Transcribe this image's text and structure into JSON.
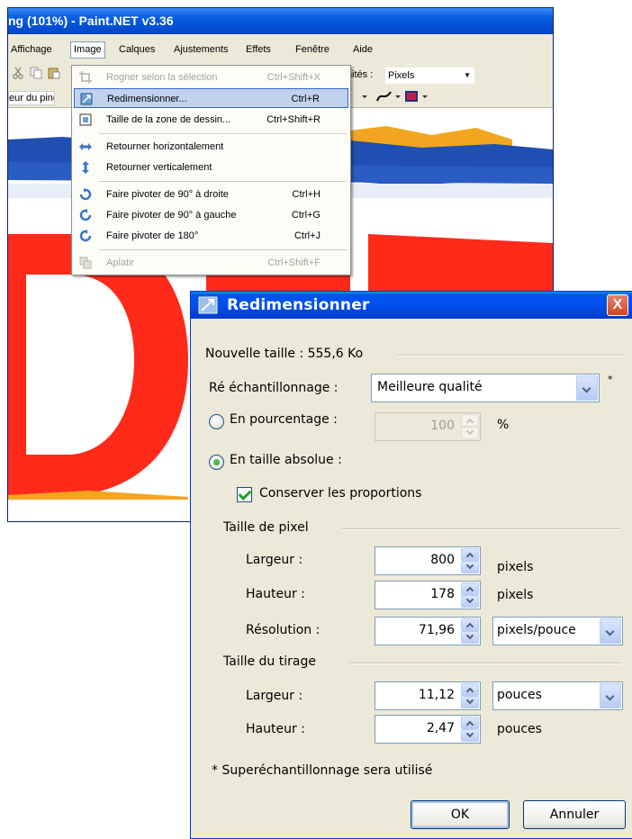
{
  "main_window": {
    "title": "ng (101%) - Paint.NET v3.36",
    "menu": [
      "Affichage",
      "Image",
      "Calques",
      "Ajustements",
      "Effets",
      "Fenêtre",
      "Aide"
    ],
    "units_label": "Unités :",
    "units_value": "Pixels",
    "brush_label": "eur du pince"
  },
  "image_menu": [
    {
      "label": "Rogner selon la sélection",
      "shortcut": "Ctrl+Shift+X",
      "disabled": true
    },
    {
      "label": "Redimensionner...",
      "shortcut": "Ctrl+R"
    },
    {
      "label": "Taille de la zone de dessin...",
      "shortcut": "Ctrl+Shift+R"
    },
    {
      "label": "Retourner horizontalement",
      "shortcut": ""
    },
    {
      "label": "Retourner verticalement",
      "shortcut": ""
    },
    {
      "label": "Faire pivoter de 90° à droite",
      "shortcut": "Ctrl+H"
    },
    {
      "label": "Faire pivoter de 90° à gauche",
      "shortcut": "Ctrl+G"
    },
    {
      "label": "Faire pivoter de 180°",
      "shortcut": "Ctrl+J"
    },
    {
      "label": "Aplatir",
      "shortcut": "Ctrl+Shift+F",
      "disabled": true
    }
  ],
  "dialog": {
    "title": "Redimensionner",
    "close": "X",
    "new_size": "Nouvelle taille : 555,6 Ko",
    "resampling_label": "Ré échantillonnage :",
    "resampling_value": "Meilleure qualité",
    "asterisk": "*",
    "by_percent_label": "En pourcentage :",
    "percent_value": "100",
    "percent_unit": "%",
    "absolute_label": "En taille absolue :",
    "keep_ratio_label": "Conserver les proportions",
    "pixel_size_group": "Taille de pixel",
    "px_width_label": "Largeur :",
    "px_width_value": "800",
    "px_width_unit": "pixels",
    "px_height_label": "Hauteur :",
    "px_height_value": "178",
    "px_height_unit": "pixels",
    "resolution_label": "Résolution :",
    "resolution_value": "71,96",
    "resolution_unit": "pixels/pouce",
    "print_size_group": "Taille du tirage",
    "print_width_label": "Largeur :",
    "print_width_value": "11,12",
    "print_width_unit": "pouces",
    "print_height_label": "Hauteur :",
    "print_height_value": "2,47",
    "print_height_unit": "pouces",
    "footnote": "* Superéchantillonnage sera utilisé",
    "ok": "OK",
    "cancel": "Annuler"
  }
}
